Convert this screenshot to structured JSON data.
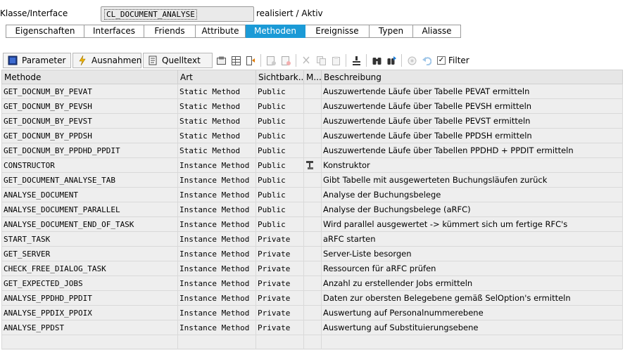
{
  "header": {
    "label": "Klasse/Interface",
    "class_name": "CL_DOCUMENT_ANALYSE",
    "status": "realisiert / Aktiv"
  },
  "tabs": [
    {
      "label": "Eigenschaften",
      "active": false
    },
    {
      "label": "Interfaces",
      "active": false
    },
    {
      "label": "Friends",
      "active": false
    },
    {
      "label": "Attribute",
      "active": false
    },
    {
      "label": "Methoden",
      "active": true
    },
    {
      "label": "Ereignisse",
      "active": false
    },
    {
      "label": "Typen",
      "active": false
    },
    {
      "label": "Aliasse",
      "active": false
    }
  ],
  "toolbar": {
    "parameter_label": "Parameter",
    "exceptions_label": "Ausnahmen",
    "source_label": "Quelltext",
    "filter_label": "Filter",
    "filter_checked": true
  },
  "table": {
    "columns": [
      "Methode",
      "Art",
      "Sichtbark...",
      "M...",
      "Beschreibung"
    ],
    "rows": [
      {
        "method": "GET_DOCNUM_BY_PEVAT",
        "type": "Static Method",
        "visibility": "Public",
        "icon": "",
        "description": "Auszuwertende Läufe über Tabelle PEVAT ermitteln"
      },
      {
        "method": "GET_DOCNUM_BY_PEVSH",
        "type": "Static Method",
        "visibility": "Public",
        "icon": "",
        "description": "Auszuwertende Läufe über Tabelle PEVSH ermitteln"
      },
      {
        "method": "GET_DOCNUM_BY_PEVST",
        "type": "Static Method",
        "visibility": "Public",
        "icon": "",
        "description": "Auszuwertende Läufe über Tabelle PEVST ermitteln"
      },
      {
        "method": "GET_DOCNUM_BY_PPDSH",
        "type": "Static Method",
        "visibility": "Public",
        "icon": "",
        "description": "Auszuwertende Läufe über Tabelle PPDSH ermitteln"
      },
      {
        "method": "GET_DOCNUM_BY_PPDHD_PPDIT",
        "type": "Static Method",
        "visibility": "Public",
        "icon": "",
        "description": "Auszuwertende Läufe über Tabellen PPDHD + PPDIT ermitteln"
      },
      {
        "method": "CONSTRUCTOR",
        "type": "Instance Method",
        "visibility": "Public",
        "icon": "constructor-icon",
        "description": "Konstruktor"
      },
      {
        "method": "GET_DOCUMENT_ANALYSE_TAB",
        "type": "Instance Method",
        "visibility": "Public",
        "icon": "",
        "description": "Gibt Tabelle mit ausgewerteten Buchungsläufen zurück"
      },
      {
        "method": "ANALYSE_DOCUMENT",
        "type": "Instance Method",
        "visibility": "Public",
        "icon": "",
        "description": "Analyse der Buchungsbelege"
      },
      {
        "method": "ANALYSE_DOCUMENT_PARALLEL",
        "type": "Instance Method",
        "visibility": "Public",
        "icon": "",
        "description": "Analyse der Buchungsbelege (aRFC)"
      },
      {
        "method": "ANALYSE_DOCUMENT_END_OF_TASK",
        "type": "Instance Method",
        "visibility": "Public",
        "icon": "",
        "description": "Wird parallel ausgewertet -> kümmert sich um fertige RFC's"
      },
      {
        "method": "START_TASK",
        "type": "Instance Method",
        "visibility": "Private",
        "icon": "",
        "description": "aRFC starten"
      },
      {
        "method": "GET_SERVER",
        "type": "Instance Method",
        "visibility": "Private",
        "icon": "",
        "description": "Server-Liste besorgen"
      },
      {
        "method": "CHECK_FREE_DIALOG_TASK",
        "type": "Instance Method",
        "visibility": "Private",
        "icon": "",
        "description": "Ressourcen für aRFC prüfen"
      },
      {
        "method": "GET_EXPECTED_JOBS",
        "type": "Instance Method",
        "visibility": "Private",
        "icon": "",
        "description": "Anzahl zu erstellender Jobs ermitteln"
      },
      {
        "method": "ANALYSE_PPDHD_PPDIT",
        "type": "Instance Method",
        "visibility": "Private",
        "icon": "",
        "description": "Daten zur obersten Belegebene gemäß SelOption's ermitteln"
      },
      {
        "method": "ANALYSE_PPDIX_PPOIX",
        "type": "Instance Method",
        "visibility": "Private",
        "icon": "",
        "description": "Auswertung auf Personalnummerebene"
      },
      {
        "method": "ANALYSE_PPDST",
        "type": "Instance Method",
        "visibility": "Private",
        "icon": "",
        "description": "Auswertung auf Substituierungsebene"
      }
    ]
  },
  "colors": {
    "active_tab": "#1b9ad6",
    "row_background": "#eeeeee",
    "header_background": "#e6e6e6"
  }
}
